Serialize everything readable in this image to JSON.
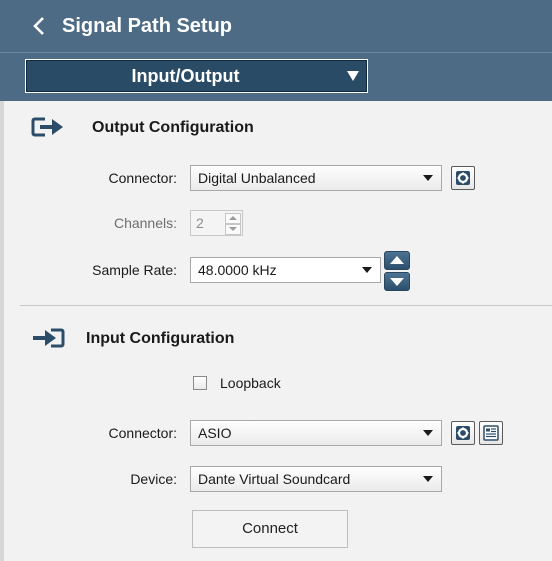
{
  "header": {
    "title": "Signal Path Setup",
    "back_icon": "chevron-left-icon"
  },
  "mode_select": {
    "value": "Input/Output"
  },
  "output": {
    "title": "Output Configuration",
    "icon": "output-arrow-icon",
    "connector_label": "Connector:",
    "connector_value": "Digital Unbalanced",
    "channels_label": "Channels:",
    "channels_value": "2",
    "sample_rate_label": "Sample Rate:",
    "sample_rate_value": "48.0000 kHz"
  },
  "input": {
    "title": "Input Configuration",
    "icon": "input-arrow-icon",
    "loopback_label": "Loopback",
    "loopback_checked": false,
    "connector_label": "Connector:",
    "connector_value": "ASIO",
    "device_label": "Device:",
    "device_value": "Dante Virtual Soundcard",
    "connect_label": "Connect"
  },
  "colors": {
    "header_bg": "#4d6b84",
    "mode_select_bg": "#2a4b66",
    "accent_stepper": "#3a5e7c"
  }
}
